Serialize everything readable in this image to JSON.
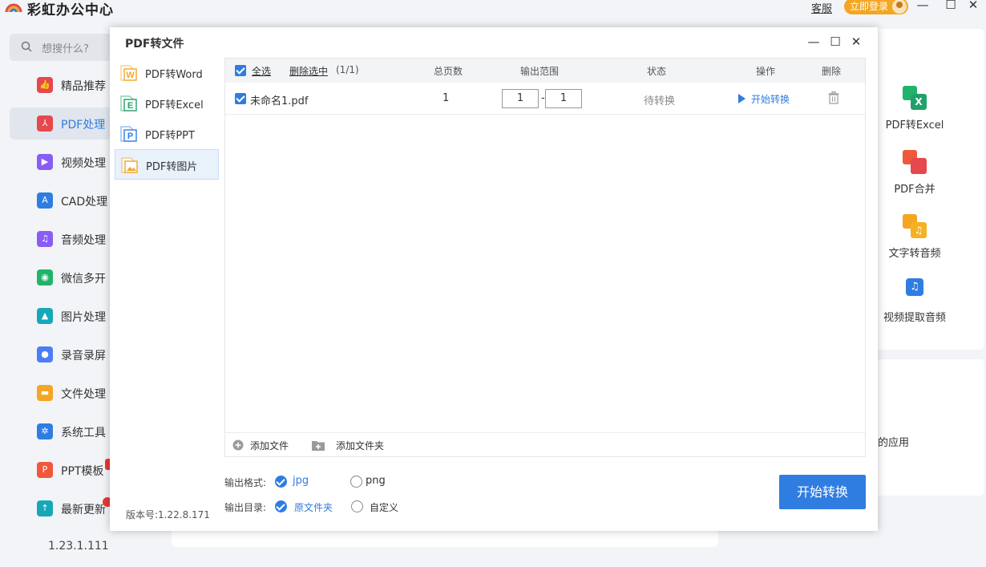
{
  "app": {
    "name": "彩虹办公中心",
    "kefu": "客服",
    "login": "立即登录",
    "version": "1.23.1.111",
    "accent": "#2f7de1",
    "login_color": "#f4a623"
  },
  "search": {
    "placeholder": "想搜什么?"
  },
  "sidebar": {
    "items": [
      {
        "label": "精品推荐",
        "icon": "thumbs-up-icon",
        "color": "#e5484d"
      },
      {
        "label": "PDF处理",
        "icon": "pdf-icon",
        "color": "#e5484d",
        "active": true
      },
      {
        "label": "视频处理",
        "icon": "play-icon",
        "color": "#8a5cf6"
      },
      {
        "label": "CAD处理",
        "icon": "cad-icon",
        "color": "#2f7de1"
      },
      {
        "label": "音频处理",
        "icon": "music-icon",
        "color": "#8a5cf6"
      },
      {
        "label": "微信多开",
        "icon": "wechat-icon",
        "color": "#22b36b"
      },
      {
        "label": "图片处理",
        "icon": "image-icon",
        "color": "#16a8b8"
      },
      {
        "label": "录音录屏",
        "icon": "mic-icon",
        "color": "#4c7ef3"
      },
      {
        "label": "文件处理",
        "icon": "folder-icon",
        "color": "#f4a623"
      },
      {
        "label": "系统工具",
        "icon": "gear-icon",
        "color": "#2f7de1"
      },
      {
        "label": "PPT模板",
        "icon": "ppt-icon",
        "color": "#f0583c"
      },
      {
        "label": "最新更新",
        "icon": "upload-icon",
        "color": "#16a8b8"
      }
    ]
  },
  "bg_tools": [
    {
      "label": "PDF转Excel",
      "icon": "pdf-to-excel-icon"
    },
    {
      "label": "PDF合并",
      "icon": "pdf-merge-icon"
    },
    {
      "label": "文字转音频",
      "icon": "text-to-audio-icon"
    },
    {
      "label": "视频提取音频",
      "icon": "video-extract-audio-icon"
    }
  ],
  "bg_apps_text": "的应用",
  "dialog": {
    "title": "PDF转文件",
    "version": "版本号:1.22.8.171",
    "side_items": [
      {
        "label": "PDF转Word",
        "letter": "W",
        "color": "#f4a623"
      },
      {
        "label": "PDF转Excel",
        "letter": "E",
        "color": "#22a06b"
      },
      {
        "label": "PDF转PPT",
        "letter": "P",
        "color": "#2f7de1"
      },
      {
        "label": "PDF转图片",
        "letter": "",
        "color": "#f4a623",
        "active": true
      }
    ],
    "table": {
      "select_all": "全选",
      "delete_selected": "删除选中",
      "count": "(1/1)",
      "headers": {
        "pages": "总页数",
        "range": "输出范围",
        "status": "状态",
        "action": "操作",
        "delete": "删除"
      },
      "rows": [
        {
          "name": "未命名1.pdf",
          "pages": "1",
          "from": "1",
          "to": "1",
          "dash": "-",
          "status": "待转换",
          "action": "开始转换"
        }
      ]
    },
    "add_file": "添加文件",
    "add_folder": "添加文件夹",
    "format_label": "输出格式:",
    "formats": [
      {
        "label": "jpg",
        "selected": true
      },
      {
        "label": "png",
        "selected": false
      }
    ],
    "dir_label": "输出目录:",
    "dirs": [
      {
        "label": "原文件夹",
        "selected": true
      },
      {
        "label": "自定义",
        "selected": false
      }
    ],
    "start_button": "开始转换"
  }
}
